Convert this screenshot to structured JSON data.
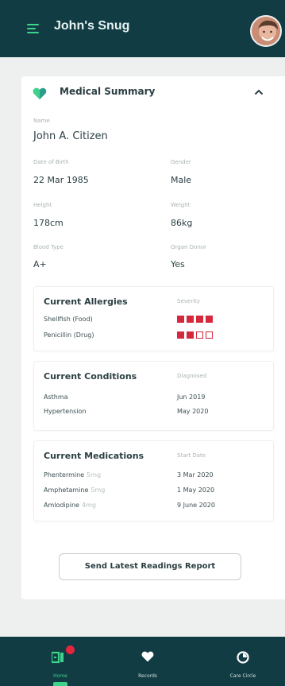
{
  "header": {
    "title": "John's Snug",
    "menu_icon": "hamburger-icon",
    "avatar_icon": "user-avatar"
  },
  "colors": {
    "primary_dark": "#123c44",
    "accent_green": "#3fd28a",
    "severity_red": "#d6283c",
    "background": "#eef0ef"
  },
  "summary": {
    "title": "Medical Summary",
    "collapse_icon": "chevron-up-icon",
    "fields": {
      "name_label": "Name",
      "name": "John A. Citizen",
      "dob_label": "Date of Birth",
      "dob": "22 Mar 1985",
      "gender_label": "Gender",
      "gender": "Male",
      "height_label": "Height",
      "height": "178cm",
      "weight_label": "Weight",
      "weight": "86kg",
      "blood_label": "Blood Type",
      "blood": "A+",
      "donor_label": "Organ Donor",
      "donor": "Yes"
    },
    "allergies": {
      "title": "Current Allergies",
      "column": "Severity",
      "items": [
        {
          "name": "Shellfish (Food)",
          "severity": 4,
          "max": 4
        },
        {
          "name": "Penicillin (Drug)",
          "severity": 2,
          "max": 4
        }
      ]
    },
    "conditions": {
      "title": "Current Conditions",
      "column": "Diagnosed",
      "items": [
        {
          "name": "Asthma",
          "date": "Jun 2019"
        },
        {
          "name": "Hypertension",
          "date": "May 2020"
        }
      ]
    },
    "medications": {
      "title": "Current Medications",
      "column": "Start Date",
      "items": [
        {
          "name": "Phentermine",
          "dose": "5mg",
          "date": "3 Mar 2020"
        },
        {
          "name": "Amphetamine",
          "dose": "5mg",
          "date": "1 May 2020"
        },
        {
          "name": "Amlodipine",
          "dose": "4mg",
          "date": "9 June 2020"
        }
      ]
    },
    "report_button": "Send Latest Readings Report"
  },
  "nav": {
    "items": [
      {
        "label": "Home",
        "icon": "home-icon",
        "active": true
      },
      {
        "label": "Records",
        "icon": "heart-icon",
        "active": false
      },
      {
        "label": "Care Circle",
        "icon": "circle-icon",
        "active": false
      }
    ]
  }
}
